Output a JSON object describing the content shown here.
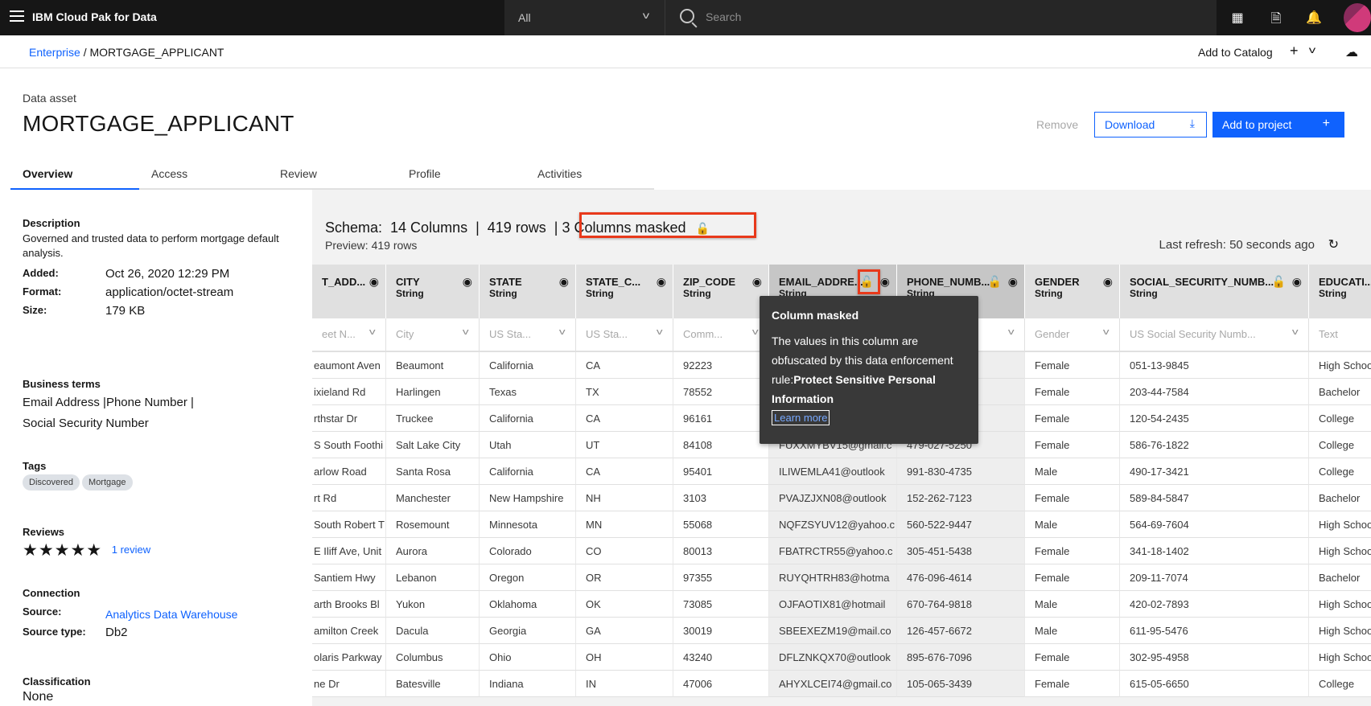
{
  "topbar": {
    "brand": "IBM Cloud Pak for Data",
    "scope": "All",
    "search_placeholder": "Search"
  },
  "breadcrumb": {
    "parent": "Enterprise",
    "current": "MORTGAGE_APPLICANT",
    "add_to_catalog": "Add to Catalog"
  },
  "asset": {
    "type_label": "Data asset",
    "title": "MORTGAGE_APPLICANT"
  },
  "actions": {
    "remove": "Remove",
    "download": "Download",
    "add_to_project": "Add to project"
  },
  "tabs": [
    {
      "label": "Overview",
      "active": true
    },
    {
      "label": "Access"
    },
    {
      "label": "Review"
    },
    {
      "label": "Profile"
    },
    {
      "label": "Activities"
    }
  ],
  "details": {
    "description_label": "Description",
    "description": "Governed and trusted data to perform mortgage default analysis.",
    "added_label": "Added:",
    "added": "Oct 26, 2020 12:29 PM",
    "format_label": "Format:",
    "format": "application/octet-stream",
    "size_label": "Size:",
    "size": "179 KB",
    "business_terms_label": "Business terms",
    "business_terms_1": "Email Address |Phone Number |",
    "business_terms_2": "Social Security Number",
    "tags_label": "Tags",
    "tags": [
      "Discovered",
      "Mortgage"
    ],
    "reviews_label": "Reviews",
    "rating": 5,
    "rating_max": 5,
    "review_link": "1 review",
    "connection_label": "Connection",
    "source_label": "Source:",
    "source": "Analytics Data Warehouse",
    "source_type_label": "Source type:",
    "source_type": "Db2",
    "classification_label": "Classification",
    "classification": "None"
  },
  "schema": {
    "summary": "Schema:  14 Columns  |  419 rows  | ",
    "masked": "3 Columns masked",
    "preview": "Preview: 419 rows",
    "last_refresh": "Last refresh: 50 seconds ago"
  },
  "tooltip": {
    "title": "Column masked",
    "body": "The values in this column are obfuscated by this data enforcement rule:",
    "rule": "Protect Sensitive Personal Information",
    "link": "Learn more"
  },
  "colors": {
    "accent": "#0f62fe",
    "highlight": "#e8391b",
    "topbar": "#161616"
  },
  "columns": [
    {
      "name": "T_ADD...",
      "type": "",
      "filter": "eet N...",
      "masked": false
    },
    {
      "name": "CITY",
      "type": "String",
      "filter": "City",
      "masked": false
    },
    {
      "name": "STATE",
      "type": "String",
      "filter": "US Sta...",
      "masked": false
    },
    {
      "name": "STATE_C...",
      "type": "String",
      "filter": "US Sta...",
      "masked": false
    },
    {
      "name": "ZIP_CODE",
      "type": "String",
      "filter": "Comm...",
      "masked": false
    },
    {
      "name": "EMAIL_ADDRE...",
      "type": "String",
      "filter": "",
      "masked": true
    },
    {
      "name": "PHONE_NUMB...",
      "type": "String",
      "filter": "",
      "masked": true
    },
    {
      "name": "GENDER",
      "type": "String",
      "filter": "Gender",
      "masked": false
    },
    {
      "name": "SOCIAL_SECURITY_NUMB...",
      "type": "String",
      "filter": "US Social Security Numb...",
      "masked": true
    },
    {
      "name": "EDUCATI...",
      "type": "String",
      "filter": "Text",
      "masked": false
    }
  ],
  "rows": [
    [
      "eaumont Aven",
      "Beaumont",
      "California",
      "CA",
      "92223",
      "",
      "",
      "Female",
      "051-13-9845",
      "High School"
    ],
    [
      "ixieland Rd",
      "Harlingen",
      "Texas",
      "TX",
      "78552",
      "",
      "",
      "Female",
      "203-44-7584",
      "Bachelor"
    ],
    [
      "rthstar Dr",
      "Truckee",
      "California",
      "CA",
      "96161",
      "",
      "",
      "Female",
      "120-54-2435",
      "College"
    ],
    [
      "S South Foothi",
      "Salt Lake City",
      "Utah",
      "UT",
      "84108",
      "FUXXMYBV15@gmail.c",
      "479-027-5250",
      "Female",
      "586-76-1822",
      "College"
    ],
    [
      "arlow Road",
      "Santa Rosa",
      "California",
      "CA",
      "95401",
      "ILIWEMLA41@outlook",
      "991-830-4735",
      "Male",
      "490-17-3421",
      "College"
    ],
    [
      "rt Rd",
      "Manchester",
      "New Hampshire",
      "NH",
      "3103",
      "PVAJZJXN08@outlook",
      "152-262-7123",
      "Female",
      "589-84-5847",
      "Bachelor"
    ],
    [
      "South Robert T",
      "Rosemount",
      "Minnesota",
      "MN",
      "55068",
      "NQFZSYUV12@yahoo.c",
      "560-522-9447",
      "Male",
      "564-69-7604",
      "High School"
    ],
    [
      "E Iliff Ave, Unit",
      "Aurora",
      "Colorado",
      "CO",
      "80013",
      "FBATRCTR55@yahoo.c",
      "305-451-5438",
      "Female",
      "341-18-1402",
      "High School"
    ],
    [
      "Santiem Hwy",
      "Lebanon",
      "Oregon",
      "OR",
      "97355",
      "RUYQHTRH83@hotma",
      "476-096-4614",
      "Female",
      "209-11-7074",
      "Bachelor"
    ],
    [
      "arth Brooks Bl",
      "Yukon",
      "Oklahoma",
      "OK",
      "73085",
      "OJFAOTIX81@hotmail",
      "670-764-9818",
      "Male",
      "420-02-7893",
      "High School"
    ],
    [
      "amilton Creek",
      "Dacula",
      "Georgia",
      "GA",
      "30019",
      "SBEEXEZM19@mail.co",
      "126-457-6672",
      "Male",
      "611-95-5476",
      "High School"
    ],
    [
      "olaris Parkway",
      "Columbus",
      "Ohio",
      "OH",
      "43240",
      "DFLZNKQX70@outlook",
      "895-676-7096",
      "Female",
      "302-95-4958",
      "High School"
    ],
    [
      "ne Dr",
      "Batesville",
      "Indiana",
      "IN",
      "47006",
      "AHYXLCEI74@gmail.co",
      "105-065-3439",
      "Female",
      "615-05-6650",
      "College"
    ]
  ]
}
